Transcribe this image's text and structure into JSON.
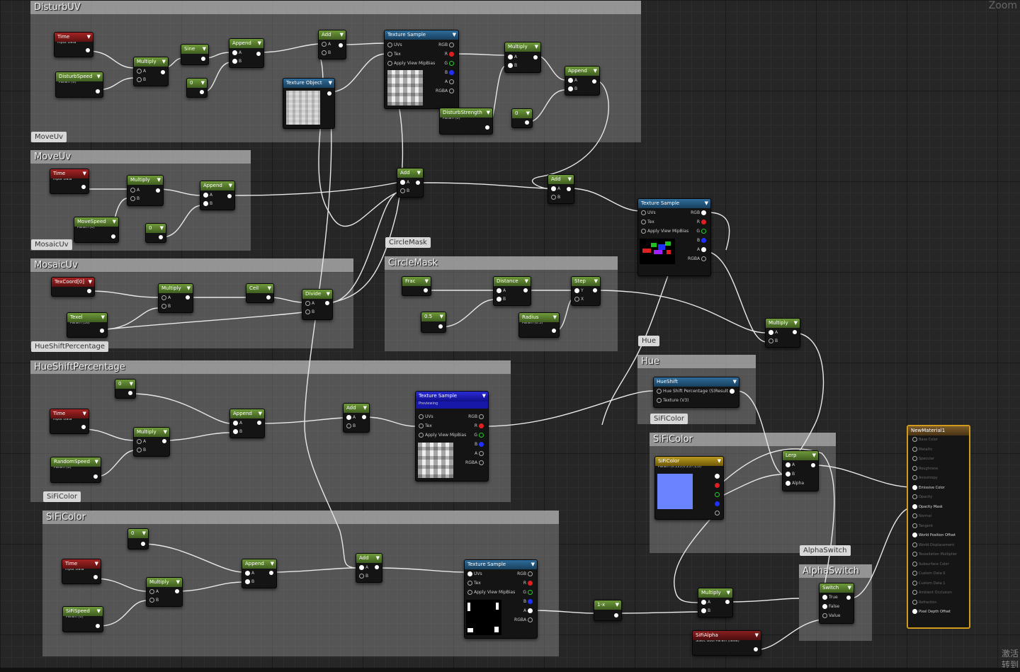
{
  "view": {
    "zoom_label": "Zoom",
    "watermark_line1": "激活",
    "watermark_line2": "转到"
  },
  "comments": [
    {
      "id": "disturbuv",
      "title": "DisturbUV"
    },
    {
      "id": "moveuv",
      "title": "MoveUv",
      "bubble": "MoveUv"
    },
    {
      "id": "mosaicuv",
      "title": "MosaicUv",
      "bubble": "MosaicUv"
    },
    {
      "id": "circlemask",
      "title": "CircleMask",
      "bubble": "CircleMask"
    },
    {
      "id": "hueshift",
      "title": "HueShiftPercentage",
      "bubble": "HueShiftPercentage"
    },
    {
      "id": "sificolor",
      "title": "SiFiColor",
      "bubble": "SiFiColor"
    },
    {
      "id": "hue",
      "title": "Hue",
      "bubble": "Hue"
    },
    {
      "id": "sificolor2",
      "title": "SiFiColor",
      "bubble": "SiFiColor"
    },
    {
      "id": "alphaswitch",
      "title": "AlphaSwitch",
      "bubble": "AlphaSwitch"
    }
  ],
  "nodes": {
    "time1": {
      "title": "Time",
      "sub": "Input Data"
    },
    "disturbspeed": {
      "title": "DisturbSpeed",
      "sub": "Param (0)"
    },
    "mul1": {
      "title": "Multiply"
    },
    "sine": {
      "title": "Sine"
    },
    "append1": {
      "title": "Append"
    },
    "zero1": {
      "title": "0"
    },
    "add1": {
      "title": "Add"
    },
    "texobj": {
      "title": "Texture Object"
    },
    "texsample1": {
      "title": "Texture Sample"
    },
    "mul2": {
      "title": "Multiply"
    },
    "disturbstrength": {
      "title": "DisturbStrength",
      "sub": "Param (0)"
    },
    "zero2": {
      "title": "0"
    },
    "append2": {
      "title": "Append"
    },
    "time2": {
      "title": "Time",
      "sub": "Input Data"
    },
    "mul3": {
      "title": "Multiply"
    },
    "append3": {
      "title": "Append"
    },
    "movespeed": {
      "title": "MoveSpeed",
      "sub": "Param (0)"
    },
    "zero3": {
      "title": "0"
    },
    "add2": {
      "title": "Add"
    },
    "add3": {
      "title": "Add"
    },
    "texsample2": {
      "title": "Texture Sample"
    },
    "texcoord": {
      "title": "TexCoord[0]"
    },
    "mul4": {
      "title": "Multiply"
    },
    "ceil": {
      "title": "Ceil"
    },
    "divide": {
      "title": "Divide"
    },
    "texel": {
      "title": "Texel",
      "sub": "Param (16)"
    },
    "frac": {
      "title": "Frac"
    },
    "distance": {
      "title": "Distance"
    },
    "step": {
      "title": "Step"
    },
    "half": {
      "title": "0.5"
    },
    "radius": {
      "title": "Radius",
      "sub": "Param (0.3)"
    },
    "mul5": {
      "title": "Multiply"
    },
    "zero4": {
      "title": "0"
    },
    "time3": {
      "title": "Time",
      "sub": "Input Data"
    },
    "append4": {
      "title": "Append"
    },
    "mul6": {
      "title": "Multiply"
    },
    "randomspeed": {
      "title": "RandomSpeed",
      "sub": "Param (0)"
    },
    "add4": {
      "title": "Add"
    },
    "texsample3": {
      "title": "Texture Sample",
      "sub": "Previewing"
    },
    "hueshift_node": {
      "title": "HueShift"
    },
    "sificolor_param": {
      "title": "SiFiColor",
      "sub": "Param (0.125,0.237,1,0)"
    },
    "lerp": {
      "title": "Lerp"
    },
    "zero5": {
      "title": "0"
    },
    "time4": {
      "title": "Time",
      "sub": "Input Data"
    },
    "append5": {
      "title": "Append"
    },
    "mul7": {
      "title": "Multiply"
    },
    "sifispeed": {
      "title": "SiFiSpeed",
      "sub": "Param (0)"
    },
    "add5": {
      "title": "Add"
    },
    "texsample4": {
      "title": "Texture Sample"
    },
    "oneminus": {
      "title": "1-x"
    },
    "mul8": {
      "title": "Multiply"
    },
    "switch": {
      "title": "Switch"
    },
    "sifialpha": {
      "title": "SiFiAlpha",
      "sub": "Static Bool Param (false)"
    }
  },
  "pins": {
    "uvs": "UVs",
    "tex": "Tex",
    "mip": "Apply View MipBias",
    "rgb": "RGB",
    "r": "R",
    "g": "G",
    "b": "B",
    "a": "A",
    "rgba": "RGBA",
    "in_a": "A",
    "in_b": "B",
    "in_y": "Y",
    "in_x": "X",
    "alpha": "Alpha",
    "hue_pct": "Hue Shift Percentage (S)",
    "hue_result": "Result",
    "hue_tex": "Texture (V3)",
    "sw_true": "True",
    "sw_false": "False",
    "sw_value": "Value"
  },
  "result_node": {
    "title": "NewMaterial1",
    "pins": [
      {
        "label": "Base Color",
        "active": false
      },
      {
        "label": "Metallic",
        "active": false
      },
      {
        "label": "Specular",
        "active": false
      },
      {
        "label": "Roughness",
        "active": false
      },
      {
        "label": "Anisotropy",
        "active": false
      },
      {
        "label": "Emissive Color",
        "active": true
      },
      {
        "label": "Opacity",
        "active": false
      },
      {
        "label": "Opacity Mask",
        "active": true
      },
      {
        "label": "Normal",
        "active": false
      },
      {
        "label": "Tangent",
        "active": false
      },
      {
        "label": "World Position Offset",
        "active": true
      },
      {
        "label": "World Displacement",
        "active": false
      },
      {
        "label": "Tessellation Multiplier",
        "active": false
      },
      {
        "label": "Subsurface Color",
        "active": false
      },
      {
        "label": "Custom Data 0",
        "active": false
      },
      {
        "label": "Custom Data 1",
        "active": false
      },
      {
        "label": "Ambient Occlusion",
        "active": false
      },
      {
        "label": "Refraction",
        "active": false
      },
      {
        "label": "Pixel Depth Offset",
        "active": true
      }
    ]
  },
  "colors": {
    "accent": "#d29a1c",
    "param_green": "#5a8a2a",
    "input_red": "#a52424",
    "tex_blue": "#2f6d9a"
  }
}
